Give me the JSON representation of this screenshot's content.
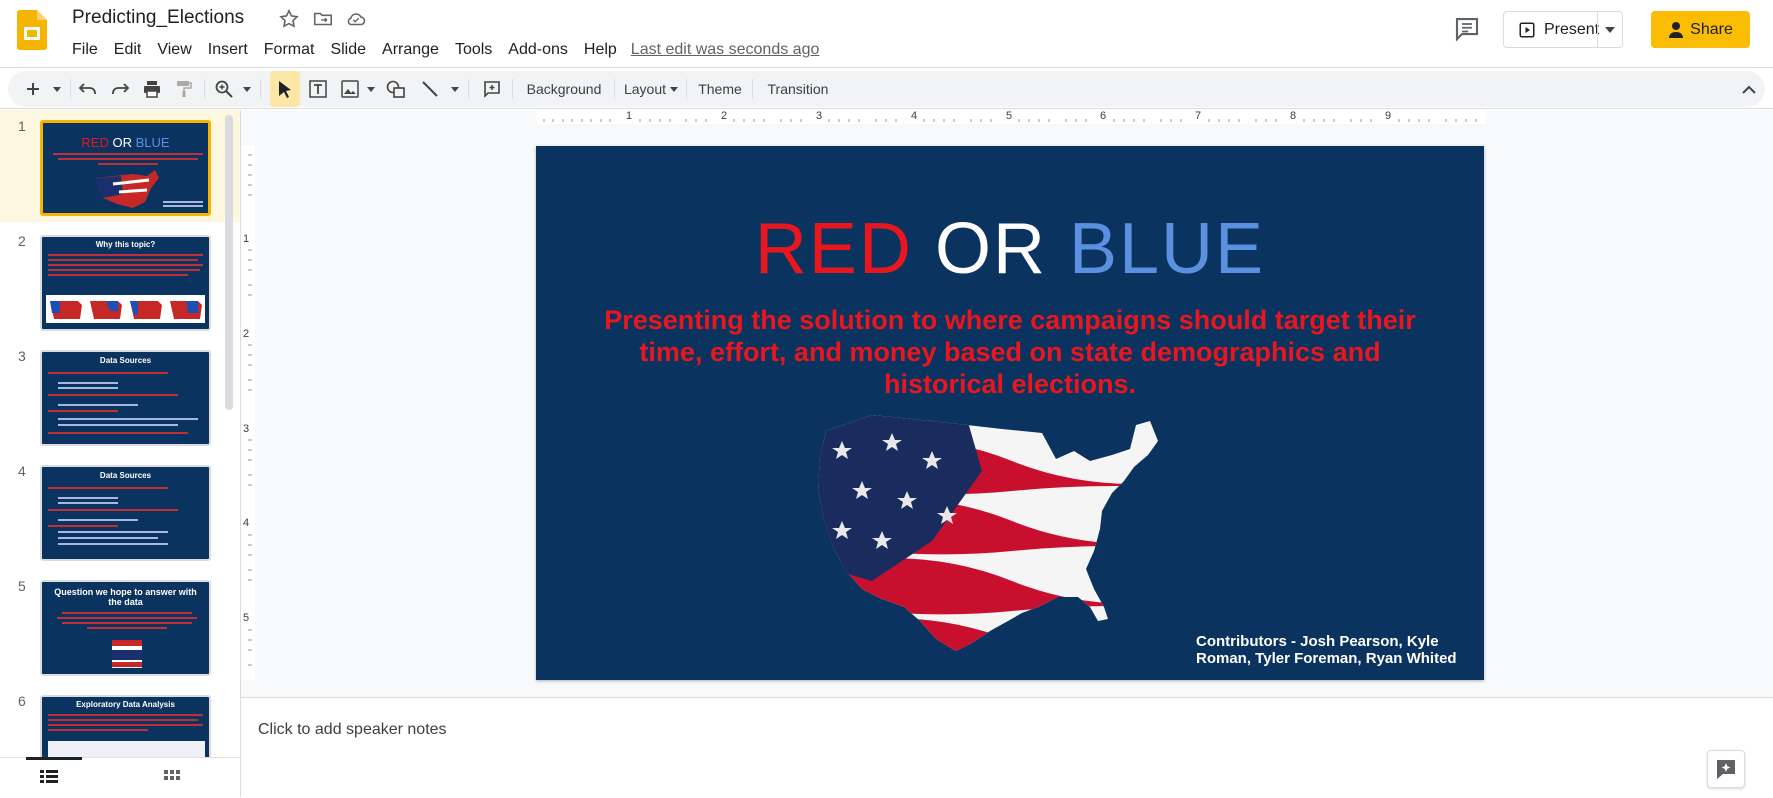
{
  "app": {
    "doc_title": "Predicting_Elections",
    "last_edit": "Last edit was seconds ago",
    "present_label": "Present",
    "share_label": "Share",
    "menu": [
      "File",
      "Edit",
      "View",
      "Insert",
      "Format",
      "Slide",
      "Arrange",
      "Tools",
      "Add-ons",
      "Help"
    ]
  },
  "toolbar": {
    "background": "Background",
    "layout": "Layout",
    "theme": "Theme",
    "transition": "Transition",
    "icons": [
      "plus-icon",
      "undo-icon",
      "redo-icon",
      "print-icon",
      "paint-format-icon",
      "zoom-icon",
      "select-icon",
      "text-box-icon",
      "image-icon",
      "shape-icon",
      "line-icon",
      "comment-add-icon",
      "collapse-icon"
    ]
  },
  "ruler": {
    "horizontal": [
      "1",
      "2",
      "3",
      "4",
      "5",
      "6",
      "7",
      "8",
      "9"
    ],
    "vertical": [
      "1",
      "2",
      "3",
      "4",
      "5"
    ]
  },
  "filmstrip": {
    "slides": [
      {
        "number": "1",
        "title": "RED OR BLUE",
        "selected": true
      },
      {
        "number": "2",
        "title": "Why this topic?"
      },
      {
        "number": "3",
        "title": "Data Sources"
      },
      {
        "number": "4",
        "title": "Data Sources"
      },
      {
        "number": "5",
        "title": "Question we hope to answer with the data"
      },
      {
        "number": "6",
        "title": "Exploratory Data Analysis"
      }
    ]
  },
  "slide": {
    "title_red": "RED",
    "title_or": "OR",
    "title_blue": "BLUE",
    "subtitle": "Presenting the solution to where campaigns should target their time, effort, and money based on state demographics and historical elections.",
    "contributors": "Contributors - Josh Pearson, Kyle Roman, Tyler Foreman, Ryan Whited",
    "colors": {
      "background": "#0b3360",
      "red": "#e8171e",
      "blue": "#5b8fe0",
      "white": "#ffffff"
    }
  },
  "notes": {
    "placeholder": "Click to add speaker notes"
  }
}
